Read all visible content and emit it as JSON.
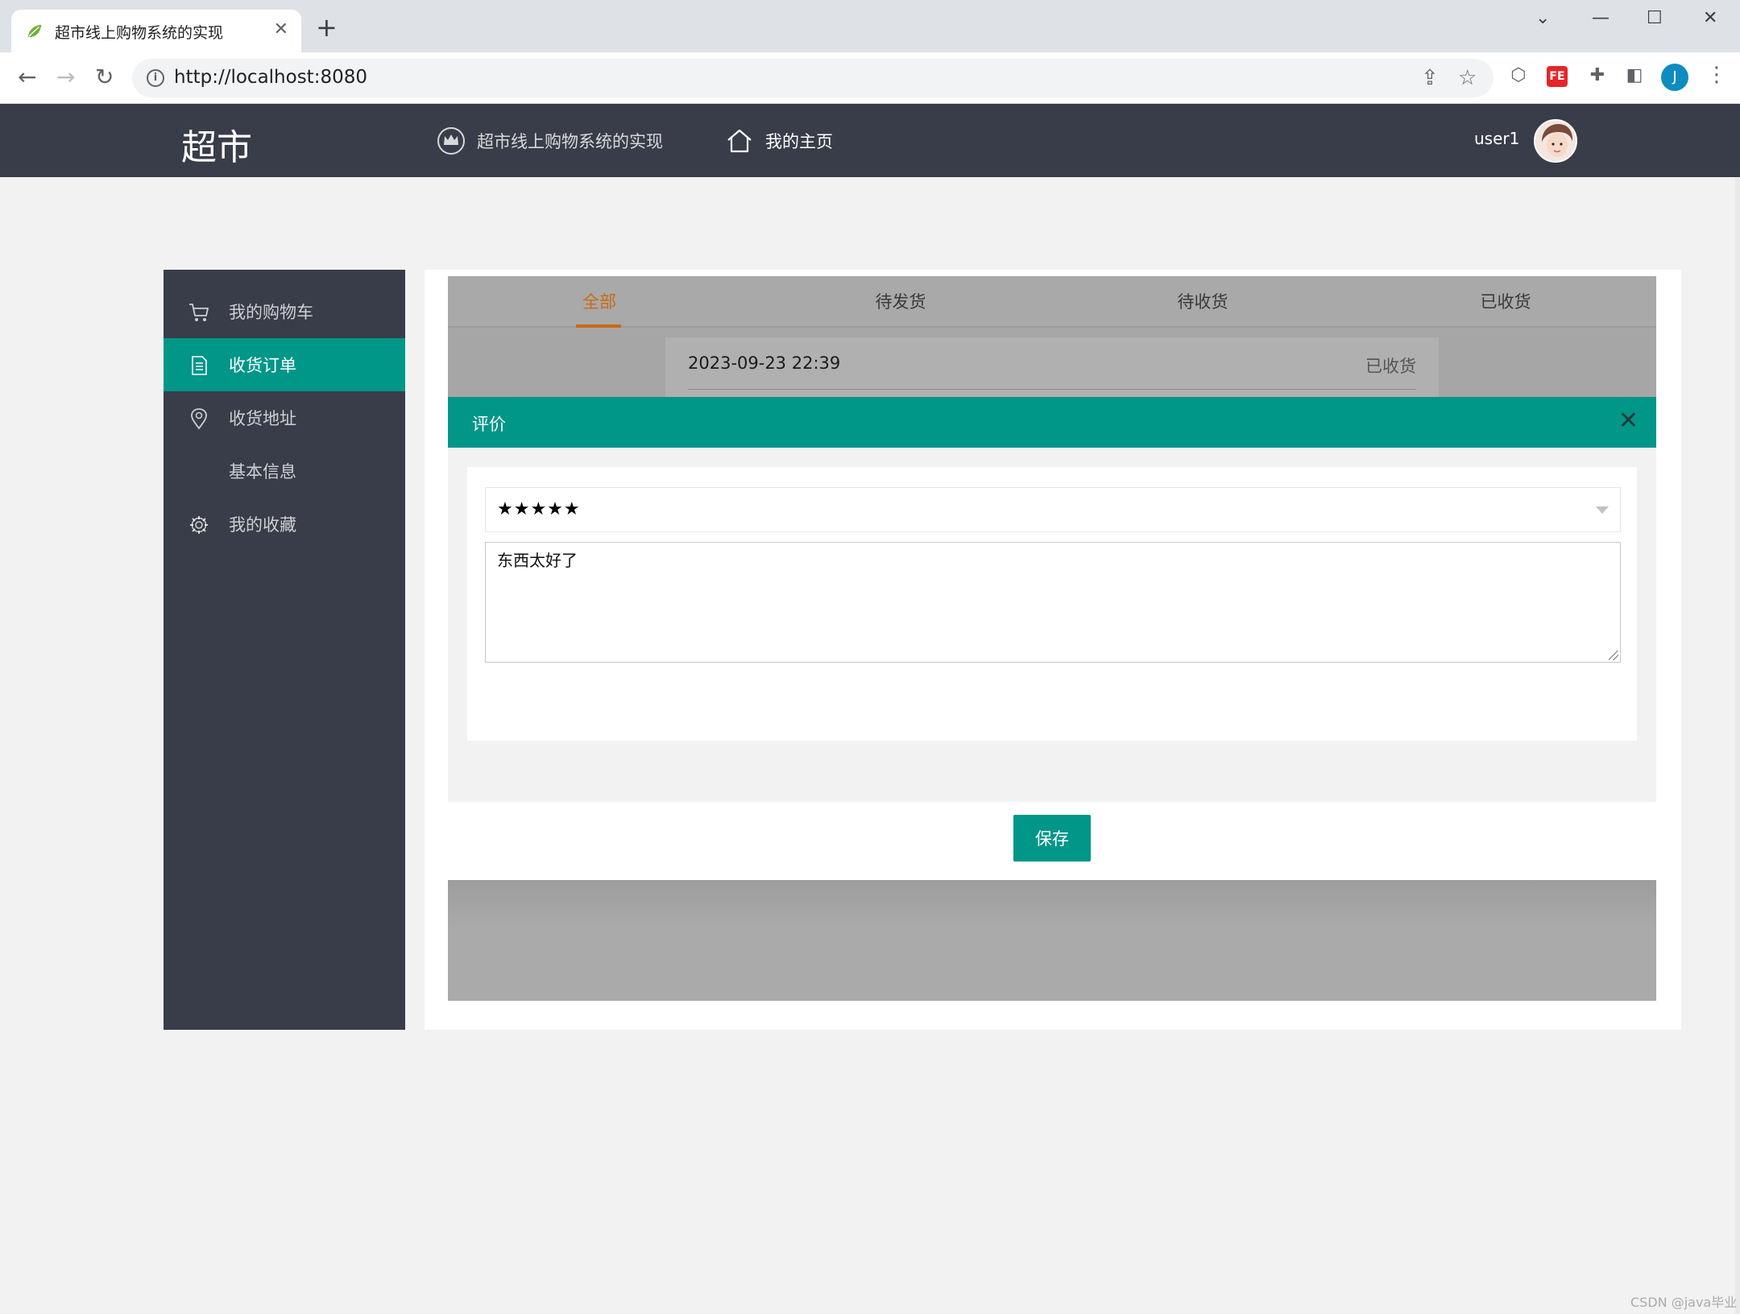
{
  "browser": {
    "tab_title": "超市线上购物系统的实现",
    "tab_close": "✕",
    "new_tab": "+",
    "url": "http://localhost:8080",
    "win_chevron": "⌄",
    "win_minimize": "—",
    "win_maximize": "☐",
    "win_close": "✕",
    "profile_initial": "J"
  },
  "header": {
    "logo": "超市",
    "nav": [
      {
        "label": "超市线上购物系统的实现",
        "icon": "crown-icon"
      },
      {
        "label": "我的主页",
        "icon": "home-icon"
      }
    ],
    "username": "user1"
  },
  "sidebar": {
    "items": [
      {
        "label": "我的购物车",
        "icon": "cart-icon"
      },
      {
        "label": "收货订单",
        "icon": "document-icon",
        "active": true
      },
      {
        "label": "收货地址",
        "icon": "location-pin-icon"
      },
      {
        "label": "基本信息",
        "icon": ""
      },
      {
        "label": "我的收藏",
        "icon": "gear-icon"
      }
    ]
  },
  "orders": {
    "tabs": [
      {
        "label": "全部",
        "active": true
      },
      {
        "label": "待发货"
      },
      {
        "label": "待收货"
      },
      {
        "label": "已收货"
      }
    ],
    "card": {
      "time": "2023-09-23 22:39",
      "status": "已收货"
    }
  },
  "dialog": {
    "title": "评价",
    "close": "✕",
    "rating_value": "★★★★★",
    "comment": "东西太好了",
    "save_label": "保存"
  },
  "watermark": "CSDN @java毕业",
  "colors": {
    "header_bg": "#393d49",
    "accent": "#009688",
    "active_tab": "#c96a12"
  }
}
